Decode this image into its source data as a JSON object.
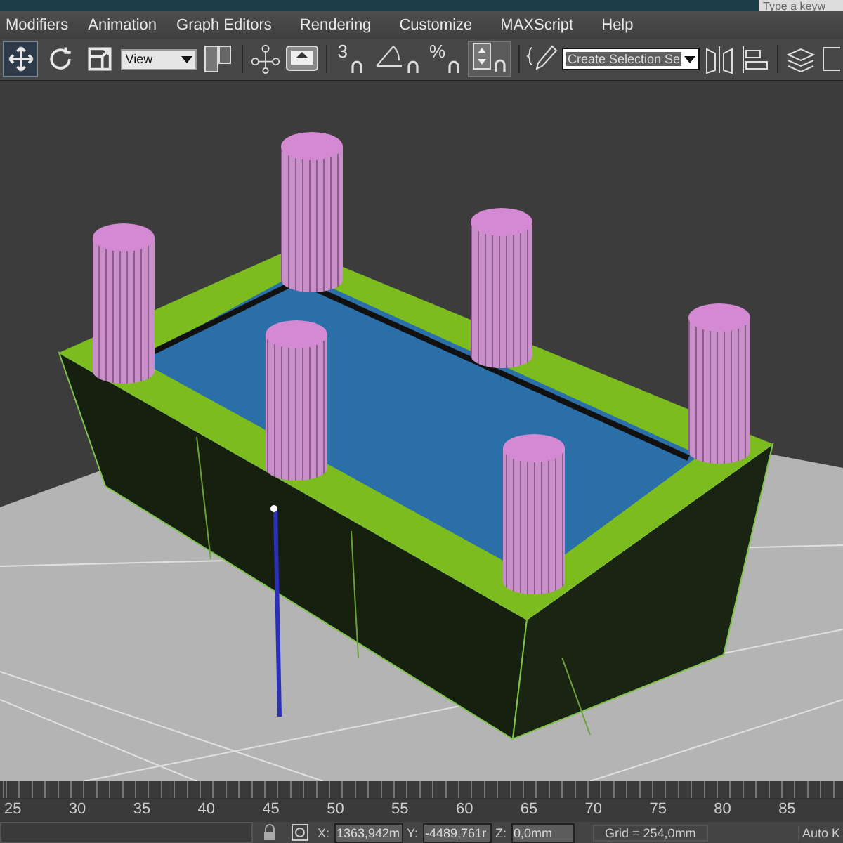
{
  "title_bar": {
    "search": {
      "placeholder": "Type a keyw"
    }
  },
  "menu": [
    "Modifiers",
    "Animation",
    "Graph Editors",
    "Rendering",
    "Customize",
    "MAXScript",
    "Help"
  ],
  "toolbar": {
    "tools": [
      {
        "kind": "move",
        "selected": true
      },
      {
        "kind": "rotate",
        "selected": false
      },
      {
        "kind": "scale",
        "selected": false
      }
    ],
    "reference_dropdown": "View",
    "snap_toggles": [
      {
        "glyph": "3",
        "selected": false
      },
      {
        "kind": "angle",
        "selected": false
      },
      {
        "glyph": "%",
        "selected": false
      },
      {
        "kind": "spinner",
        "selected": true
      }
    ],
    "selection_set_dropdown": "Create Selection Se"
  },
  "timeline": {
    "ticks": [
      "25",
      "30",
      "35",
      "40",
      "45",
      "50",
      "55",
      "60",
      "65",
      "70",
      "75",
      "80",
      "85"
    ]
  },
  "status_bar": {
    "x_label": "X:",
    "x_value": "1363,942m",
    "y_label": "Y:",
    "y_value": "-4489,761r",
    "z_label": "Z:",
    "z_value": "0,0mm",
    "grid": "Grid = 254,0mm",
    "auto_key": "Auto K"
  }
}
